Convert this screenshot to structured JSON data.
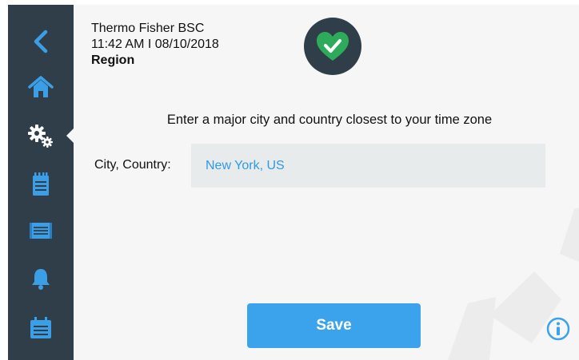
{
  "device": {
    "name": "Thermo Fisher BSC",
    "datetime": "11:42 AM I 08/10/2018",
    "screen_title": "Region"
  },
  "sidebar": {
    "items": [
      {
        "icon": "back-arrow-icon",
        "active": false
      },
      {
        "icon": "home-icon",
        "active": false
      },
      {
        "icon": "settings-gears-icon",
        "active": true
      },
      {
        "icon": "notepad-icon",
        "active": false
      },
      {
        "icon": "display-panel-icon",
        "active": false
      },
      {
        "icon": "bell-icon",
        "active": false
      },
      {
        "icon": "calendar-list-icon",
        "active": false
      }
    ]
  },
  "status": {
    "icon": "heart-check-icon",
    "color": "#2eab5a"
  },
  "main": {
    "instruction": "Enter a major city and country closest to your time zone",
    "field_label": "City, Country:",
    "city_value": "New York, US"
  },
  "buttons": {
    "save_label": "Save"
  },
  "colors": {
    "sidebar": "#2f3e48",
    "icon": "#3a9fe6",
    "accent": "#3ba3ec",
    "input_text": "#2f9ae5",
    "background": "#f6f6f6"
  }
}
